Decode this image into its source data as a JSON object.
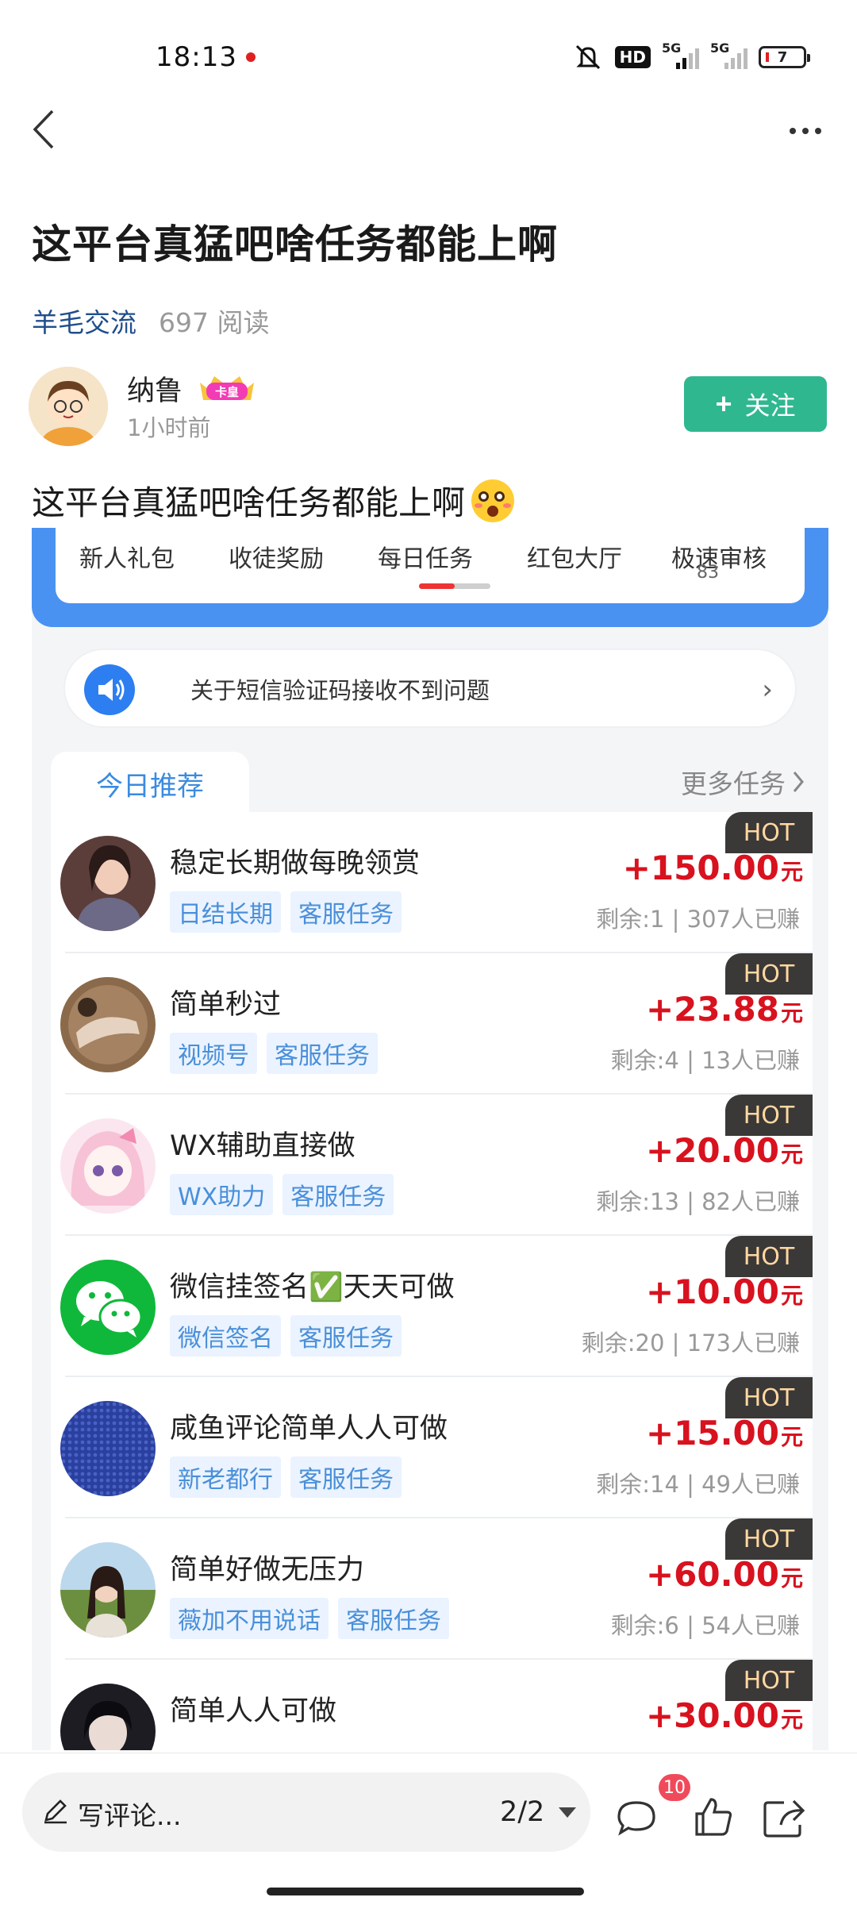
{
  "status_bar": {
    "time": "18:13",
    "hd_badge": "HD",
    "network_1": "5G",
    "network_2": "5G",
    "battery": "7"
  },
  "post": {
    "title": "这平台真猛吧啥任务都能上啊",
    "category": "羊毛交流",
    "reads": "697 阅读",
    "author": {
      "name": "纳鲁",
      "badge": "卡皇",
      "time": "1小时前"
    },
    "follow_label": "关注",
    "body_text": "这平台真猛吧啥任务都能上啊"
  },
  "screenshot": {
    "tabs": [
      {
        "label": "新人礼包"
      },
      {
        "label": "收徒奖励"
      },
      {
        "label": "每日任务"
      },
      {
        "label": "红包大厅"
      },
      {
        "label": "极速审核"
      }
    ],
    "tab_count": "83",
    "notice": "关于短信验证码接收不到问题",
    "rec_tab": "今日推荐",
    "more_tasks": "更多任务",
    "hot_label": "HOT",
    "tasks": [
      {
        "title": "稳定长期做每晚领赏",
        "tags": [
          "日结长期",
          "客服任务"
        ],
        "price": "+150.00",
        "unit": "元",
        "stat": "剩余:1 | 307人已赚"
      },
      {
        "title": "简单秒过",
        "tags": [
          "视频号",
          "客服任务"
        ],
        "price": "+23.88",
        "unit": "元",
        "stat": "剩余:4 | 13人已赚"
      },
      {
        "title": "WX辅助直接做",
        "tags": [
          "WX助力",
          "客服任务"
        ],
        "price": "+20.00",
        "unit": "元",
        "stat": "剩余:13 | 82人已赚"
      },
      {
        "title": "微信挂签名✅天天可做",
        "tags": [
          "微信签名",
          "客服任务"
        ],
        "price": "+10.00",
        "unit": "元",
        "stat": "剩余:20 | 173人已赚"
      },
      {
        "title": "咸鱼评论简单人人可做",
        "tags": [
          "新老都行",
          "客服任务"
        ],
        "price": "+15.00",
        "unit": "元",
        "stat": "剩余:14 | 49人已赚"
      },
      {
        "title": "简单好做无压力",
        "tags": [
          "薇加不用说话",
          "客服任务"
        ],
        "price": "+60.00",
        "unit": "元",
        "stat": "剩余:6 | 54人已赚"
      },
      {
        "title": "简单人人可做",
        "tags": [
          "",
          ""
        ],
        "price": "+30.00",
        "unit": "元",
        "stat": ""
      }
    ]
  },
  "bottom_bar": {
    "comment_placeholder": "写评论...",
    "page": "2/2",
    "comment_count": "10"
  },
  "colors": {
    "follow": "#2fb790",
    "price": "#d8121e",
    "tab_blue": "#4a92f2",
    "tag_text": "#4a8fd9"
  }
}
